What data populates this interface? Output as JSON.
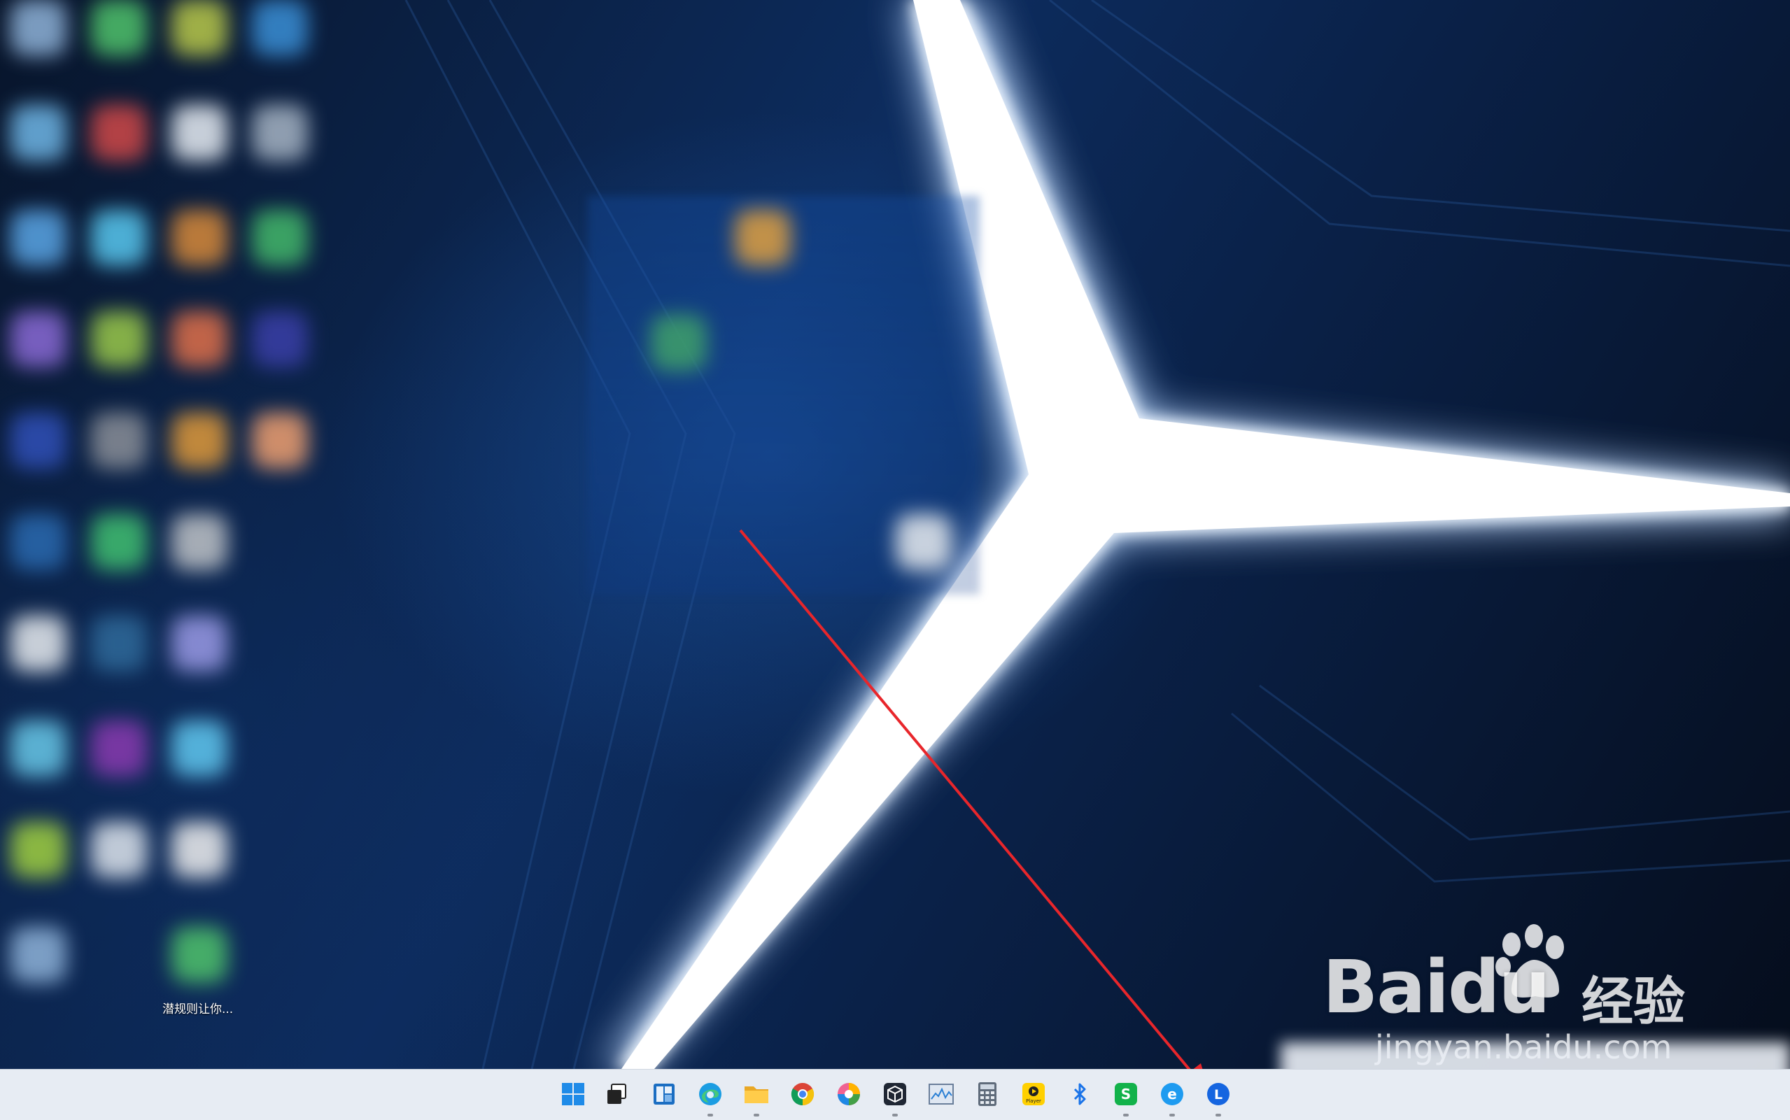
{
  "desktop": {
    "visible_icon_label": "潜规则让你..."
  },
  "watermark": {
    "brand": "Baidu",
    "brand_cn": "经验",
    "url": "jingyan.baidu.com"
  },
  "taskbar": {
    "items": [
      {
        "name": "start",
        "icon": "windows-logo-icon"
      },
      {
        "name": "task-view",
        "icon": "task-view-icon"
      },
      {
        "name": "widgets",
        "icon": "widgets-icon"
      },
      {
        "name": "edge",
        "icon": "edge-icon"
      },
      {
        "name": "file-explorer",
        "icon": "folder-icon"
      },
      {
        "name": "chrome",
        "icon": "chrome-icon"
      },
      {
        "name": "color-app",
        "icon": "color-wheel-icon"
      },
      {
        "name": "cube-app",
        "icon": "cube-icon"
      },
      {
        "name": "monitor-app",
        "icon": "chart-window-icon"
      },
      {
        "name": "calculator",
        "icon": "calculator-icon"
      },
      {
        "name": "player",
        "icon": "player-icon",
        "label": "Player"
      },
      {
        "name": "bluetooth",
        "icon": "bluetooth-icon"
      },
      {
        "name": "s-app",
        "icon": "s-app-icon",
        "label": "S"
      },
      {
        "name": "e-browser",
        "icon": "e-browser-icon",
        "label": "e"
      },
      {
        "name": "l-app",
        "icon": "l-app-icon",
        "label": "L"
      }
    ]
  },
  "colors": {
    "taskbar_bg": "#e7ecf3",
    "arrow": "#e8262b",
    "wallpaper_dark": "#061225",
    "wallpaper_mid": "#0d2c5e"
  }
}
